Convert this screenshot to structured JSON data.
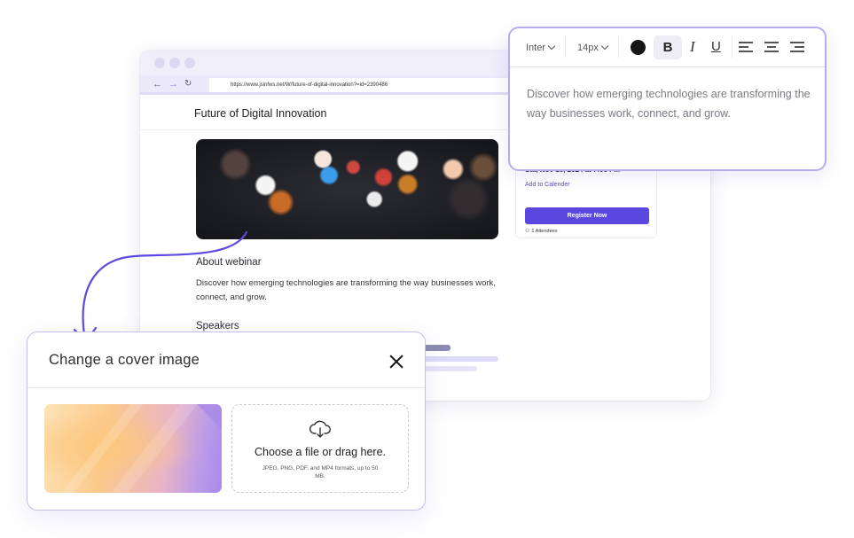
{
  "browser": {
    "url": "https://www.jsinfws.net/W/future-of-digital-innovation?=id=2390486",
    "nav": {
      "back": "←",
      "forward": "→",
      "reload": "↻"
    },
    "page_title": "Future of Digital Innovation",
    "about_heading": "About webinar",
    "about_text": "Discover how emerging technologies are transforming the way businesses work, connect, and grow.",
    "speakers_heading": "Speakers",
    "event": {
      "date_text": "Sat, Nov 16, 2024 at 7:00 PM",
      "add_to_calendar": "Add to Calender",
      "register_button": "Register Now",
      "attendees": "1 Attendees"
    }
  },
  "editor": {
    "font_family": "Inter",
    "font_size": "14px",
    "text_color": "#161616",
    "bold_label": "B",
    "italic_label": "I",
    "underline_label": "U",
    "body_text": "Discover how emerging technologies are transforming the way businesses work, connect, and grow."
  },
  "modal": {
    "title": "Change a cover image",
    "upload_title": "Choose a file or drag here.",
    "upload_note": "JPEG, PNG, PDF, and MP4 formats, up to 50 MB."
  },
  "colors": {
    "accent": "#5a48de",
    "border_accent": "#b8acef",
    "arrow": "#5d4ae0"
  },
  "icons": [
    "close-icon",
    "cloud-upload-icon",
    "align-left-icon",
    "align-center-icon",
    "align-right-icon",
    "person-icon",
    "chevron-down-icon"
  ]
}
